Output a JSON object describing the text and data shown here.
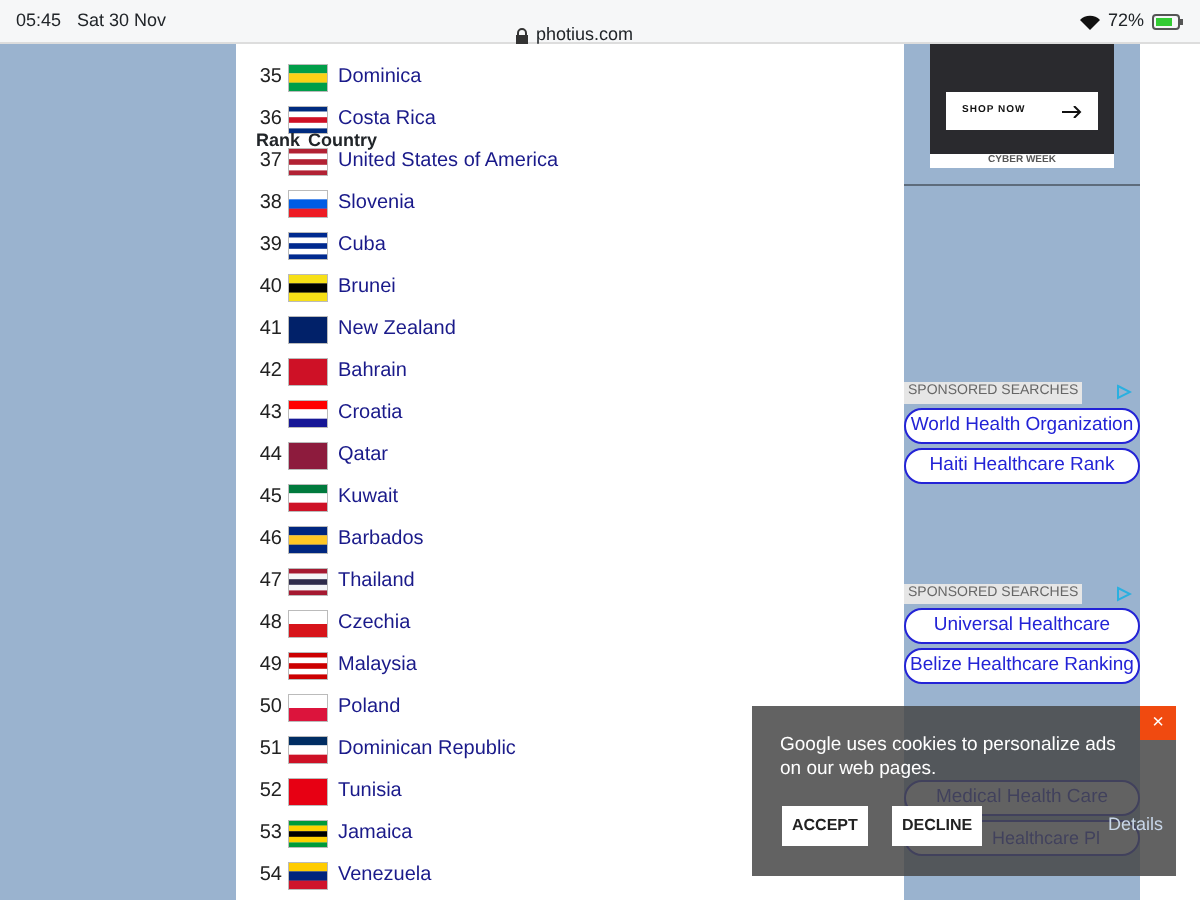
{
  "status_bar": {
    "time": "05:45",
    "date": "Sat 30 Nov",
    "url": "photius.com",
    "battery": "72%"
  },
  "table_header": {
    "columns": [
      "Rank",
      "Country"
    ]
  },
  "rows": [
    {
      "rank": "35",
      "country": "Dominica"
    },
    {
      "rank": "36",
      "country": "Costa Rica"
    },
    {
      "rank": "37",
      "country": "United States of America"
    },
    {
      "rank": "38",
      "country": "Slovenia"
    },
    {
      "rank": "39",
      "country": "Cuba"
    },
    {
      "rank": "40",
      "country": "Brunei"
    },
    {
      "rank": "41",
      "country": "New Zealand"
    },
    {
      "rank": "42",
      "country": "Bahrain"
    },
    {
      "rank": "43",
      "country": "Croatia"
    },
    {
      "rank": "44",
      "country": "Qatar"
    },
    {
      "rank": "45",
      "country": "Kuwait"
    },
    {
      "rank": "46",
      "country": "Barbados"
    },
    {
      "rank": "47",
      "country": "Thailand"
    },
    {
      "rank": "48",
      "country": "Czechia"
    },
    {
      "rank": "49",
      "country": "Malaysia"
    },
    {
      "rank": "50",
      "country": "Poland"
    },
    {
      "rank": "51",
      "country": "Dominican Republic"
    },
    {
      "rank": "52",
      "country": "Tunisia"
    },
    {
      "rank": "53",
      "country": "Jamaica"
    },
    {
      "rank": "54",
      "country": "Venezuela"
    }
  ],
  "sidebar": {
    "banner_ad": {
      "button": "SHOP NOW",
      "caption": "CYBER WEEK"
    },
    "sponsored_blocks": [
      {
        "label": "SPONSORED SEARCHES",
        "links": [
          "World Health Organization",
          "Haiti Healthcare Rank"
        ]
      },
      {
        "label": "SPONSORED SEARCHES",
        "links": [
          "Universal Healthcare",
          "Belize Healthcare Ranking"
        ]
      },
      {
        "links": [
          "Medical Health Care",
          "Healthcare Pl"
        ]
      }
    ]
  },
  "cookie_banner": {
    "message": "Google uses cookies to personalize ads on our web pages.",
    "buttons": [
      "ACCEPT",
      "DECLINE"
    ],
    "details": "Details",
    "close": "×"
  }
}
